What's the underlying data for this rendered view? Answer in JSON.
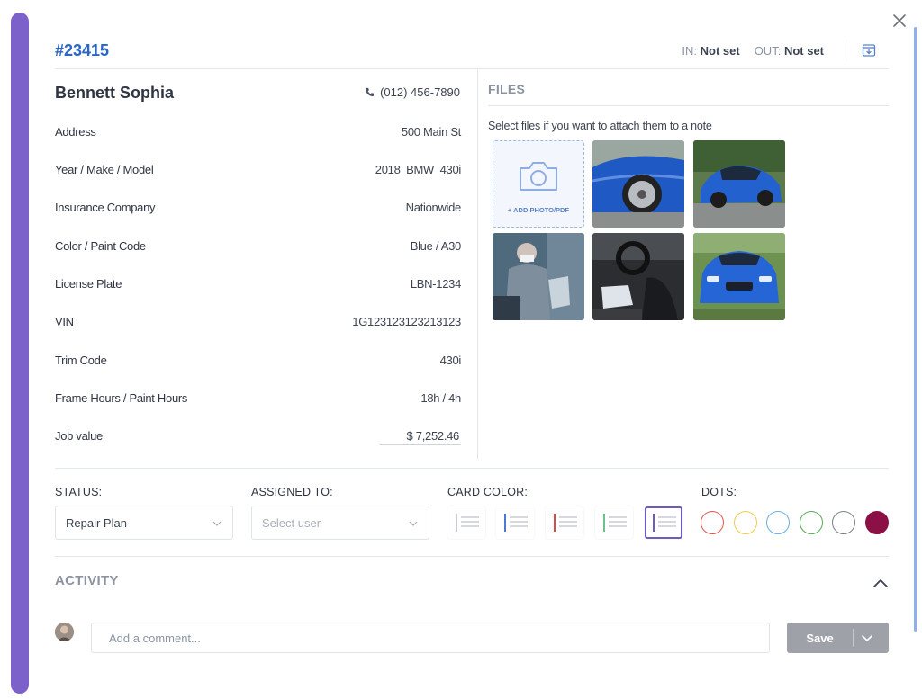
{
  "header": {
    "job_id": "#23415",
    "in_label": "IN:",
    "in_value": "Not set",
    "out_label": "OUT:",
    "out_value": "Not set"
  },
  "customer": {
    "name": "Bennett Sophia",
    "phone": "(012) 456-7890"
  },
  "details": [
    {
      "label": "Address",
      "value": "500 Main St"
    },
    {
      "label": "Year / Make / Model",
      "value": "2018  BMW  430i"
    },
    {
      "label": "Insurance Company",
      "value": "Nationwide"
    },
    {
      "label": "Color / Paint Code",
      "value": "Blue / A30"
    },
    {
      "label": "License Plate",
      "value": "LBN-1234"
    },
    {
      "label": "VIN",
      "value": "1G123123123213123"
    },
    {
      "label": "Trim Code",
      "value": "430i"
    },
    {
      "label": "Frame Hours / Paint Hours",
      "value": "18h / 4h"
    },
    {
      "label": "Job value",
      "value": "$ 7,252.46"
    }
  ],
  "files": {
    "title": "FILES",
    "hint": "Select files if you want to attach them to a note",
    "add_label": "+ ADD PHOTO/PDF",
    "thumbnails": [
      "car-front-wheel",
      "car-side-view",
      "technician-painting",
      "car-interior",
      "car-front-grass"
    ]
  },
  "status": {
    "label": "STATUS:",
    "value": "Repair Plan"
  },
  "assigned": {
    "label": "ASSIGNED TO:",
    "placeholder": "Select user"
  },
  "card_color": {
    "label": "CARD COLOR:",
    "options": [
      "#c9ccd3",
      "#4a78d4",
      "#d94a4a",
      "#6cc28a",
      "#6f5bbd"
    ],
    "selected_index": 4
  },
  "dots": {
    "label": "DOTS:",
    "colors": [
      "#e05555",
      "#f2c94c",
      "#6aaee0",
      "#5aa85a",
      "#7a7f88",
      "#8b1046"
    ],
    "filled_index": 5
  },
  "activity": {
    "title": "ACTIVITY",
    "comment_placeholder": "Add a comment...",
    "save_label": "Save"
  },
  "colors": {
    "accent": "#7b61c9",
    "link": "#2a66c4",
    "save_button": "#9ea1a8"
  },
  "icons": [
    "close-icon",
    "archive-icon",
    "phone-icon",
    "camera-icon",
    "chevron-down-icon",
    "chevron-up-icon"
  ]
}
